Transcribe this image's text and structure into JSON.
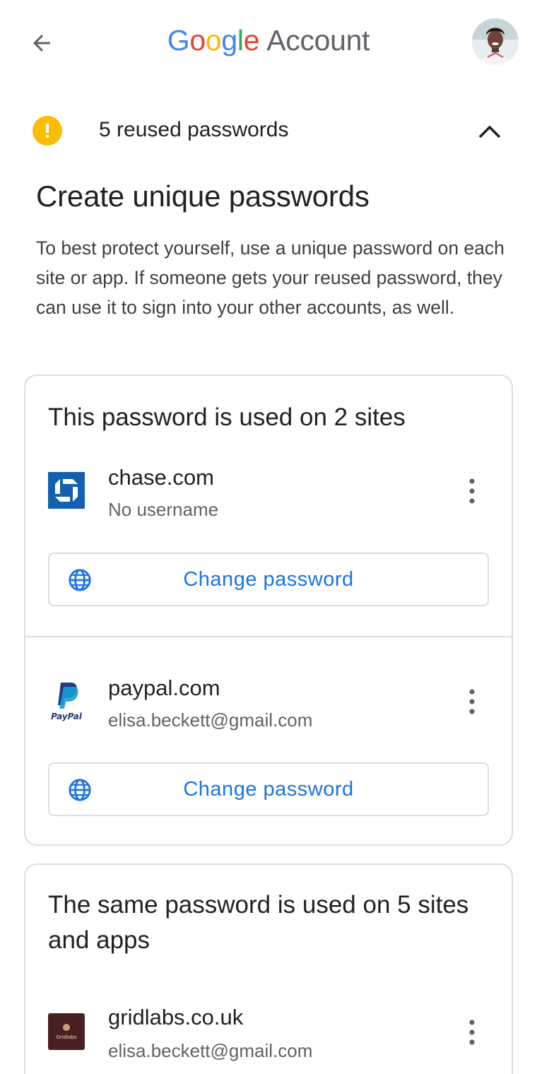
{
  "header": {
    "brand_word": "Google",
    "brand_suffix": "Account",
    "brand_colors": [
      "#4285f4",
      "#ea4335",
      "#fbbc05",
      "#4285f4",
      "#34a853",
      "#ea4335"
    ],
    "back_icon": "arrow-left-icon",
    "avatar_icon": "user-avatar"
  },
  "warning": {
    "text": "5 reused passwords",
    "icon": "exclamation-icon",
    "icon_color": "#fbbc04",
    "toggle_icon": "chevron-up-icon"
  },
  "main": {
    "heading": "Create unique passwords",
    "description": "To best protect yourself, use a unique password on each site or app. If someone gets your reused password, they can use it to sign into your other accounts, as well."
  },
  "groups": [
    {
      "title": "This password is used on 2 sites",
      "sites": [
        {
          "name": "chase.com",
          "user": "No username",
          "logo": "chase-logo",
          "action": "Change password"
        },
        {
          "name": "paypal.com",
          "user": "elisa.beckett@gmail.com",
          "logo": "paypal-logo",
          "logo_text": "PayPal",
          "action": "Change password"
        }
      ]
    },
    {
      "title": "The same password is used on 5 sites and apps",
      "sites": [
        {
          "name": "gridlabs.co.uk",
          "user": "elisa.beckett@gmail.com",
          "logo": "gridlabs-logo",
          "logo_text": "Gridlabs"
        }
      ]
    }
  ],
  "colors": {
    "accent": "#1a73e8",
    "chase_blue": "#1161b0",
    "gridlabs_bg": "#4a1f22"
  }
}
